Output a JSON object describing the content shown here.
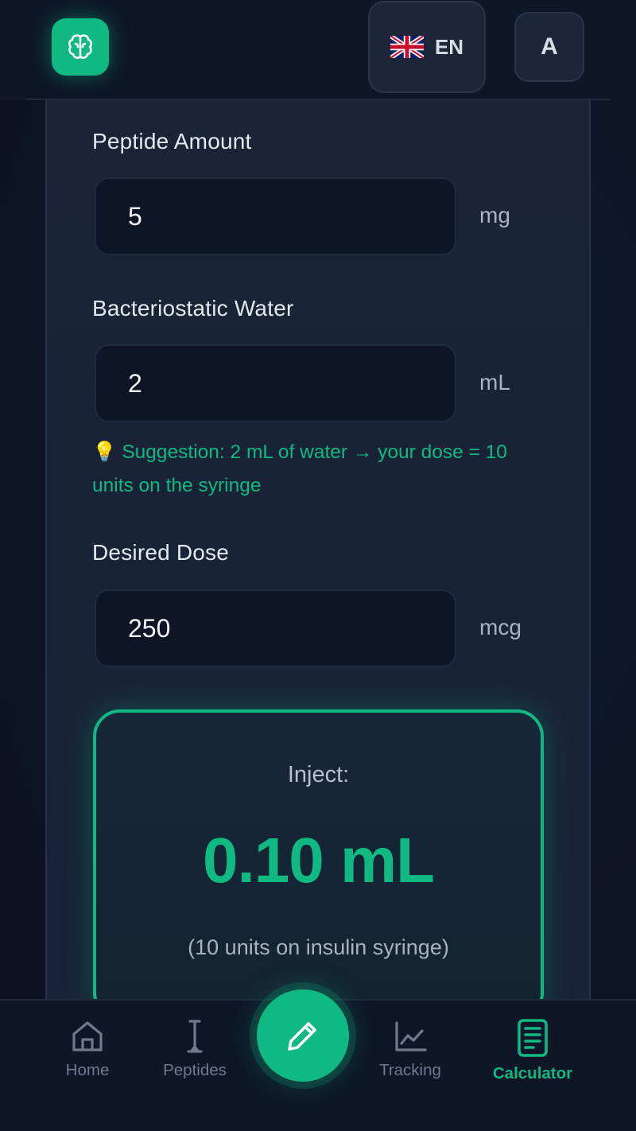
{
  "header": {
    "logo_icon": "brain-icon",
    "language": {
      "code": "EN",
      "flag_icon": "uk-flag-icon"
    },
    "avatar_initial": "A"
  },
  "form": {
    "peptide_amount": {
      "label": "Peptide Amount",
      "value": "5",
      "unit": "mg"
    },
    "water": {
      "label": "Bacteriostatic Water",
      "value": "2",
      "unit": "mL"
    },
    "suggestion": {
      "icon": "💡",
      "text": "Suggestion: 2 mL of water → your dose = 10 units on the syringe"
    },
    "desired_dose": {
      "label": "Desired Dose",
      "value": "250",
      "unit": "mcg"
    }
  },
  "result": {
    "title": "Inject:",
    "value": "0.10 mL",
    "note": "(10 units on insulin syringe)"
  },
  "nav": {
    "items": [
      {
        "label": "Home",
        "icon": "home-icon"
      },
      {
        "label": "Peptides",
        "icon": "syringe-icon"
      },
      {
        "label": "Tracking",
        "icon": "chart-icon"
      },
      {
        "label": "Calculator",
        "icon": "calculator-icon",
        "active": true
      }
    ],
    "fab_icon": "pencil-icon"
  },
  "colors": {
    "accent": "#10b981",
    "background": "#0d1425",
    "card": "#1a2436",
    "input": "#0e1526"
  }
}
